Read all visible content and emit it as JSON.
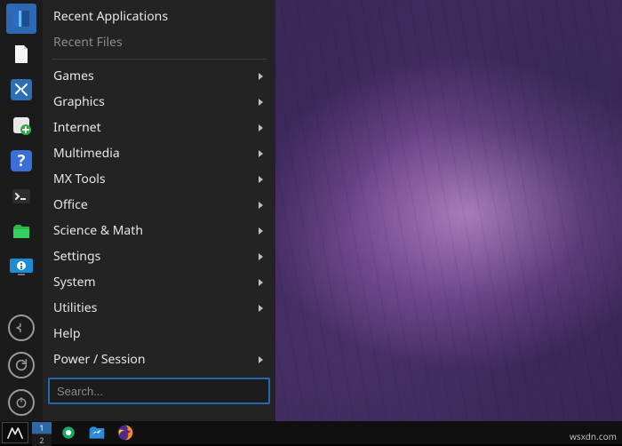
{
  "menu": {
    "recentApplications": "Recent Applications",
    "recentFiles": "Recent Files",
    "categories": [
      {
        "key": "games",
        "label": "Games",
        "submenu": true
      },
      {
        "key": "graphics",
        "label": "Graphics",
        "submenu": true
      },
      {
        "key": "internet",
        "label": "Internet",
        "submenu": true
      },
      {
        "key": "multimedia",
        "label": "Multimedia",
        "submenu": true
      },
      {
        "key": "mxtools",
        "label": "MX Tools",
        "submenu": true
      },
      {
        "key": "office",
        "label": "Office",
        "submenu": true
      },
      {
        "key": "science",
        "label": "Science & Math",
        "submenu": true
      },
      {
        "key": "settings",
        "label": "Settings",
        "submenu": true
      },
      {
        "key": "system",
        "label": "System",
        "submenu": true
      },
      {
        "key": "utilities",
        "label": "Utilities",
        "submenu": true
      },
      {
        "key": "help",
        "label": "Help",
        "submenu": false
      },
      {
        "key": "power",
        "label": "Power / Session",
        "submenu": true
      }
    ],
    "searchPlaceholder": "Search..."
  },
  "launcher": {
    "items": [
      {
        "key": "panel-config",
        "icon": "panel-icon",
        "active": true
      },
      {
        "key": "document",
        "icon": "document-icon",
        "active": false
      },
      {
        "key": "tools",
        "icon": "tools-icon",
        "active": false
      },
      {
        "key": "add-app",
        "icon": "add-app-icon",
        "active": false
      },
      {
        "key": "help",
        "icon": "help-icon",
        "active": false
      },
      {
        "key": "terminal",
        "icon": "terminal-icon",
        "active": false
      },
      {
        "key": "files",
        "icon": "folder-icon",
        "active": false
      },
      {
        "key": "info",
        "icon": "info-icon",
        "active": false
      }
    ],
    "session": [
      {
        "key": "logout",
        "icon": "logout-icon"
      },
      {
        "key": "restart",
        "icon": "restart-icon"
      },
      {
        "key": "shutdown",
        "icon": "power-icon"
      }
    ]
  },
  "taskbar": {
    "workspaces": {
      "ws1": "1",
      "ws2": "2",
      "active": 1
    },
    "pinned": [
      {
        "key": "updater",
        "icon": "shield-icon"
      },
      {
        "key": "files",
        "icon": "files-task-icon"
      },
      {
        "key": "firefox",
        "icon": "firefox-icon"
      }
    ]
  },
  "colors": {
    "accent": "#2766b6",
    "panel": "#232323",
    "panelDark": "#1b1b1b"
  },
  "watermark": "wsxdn.com"
}
